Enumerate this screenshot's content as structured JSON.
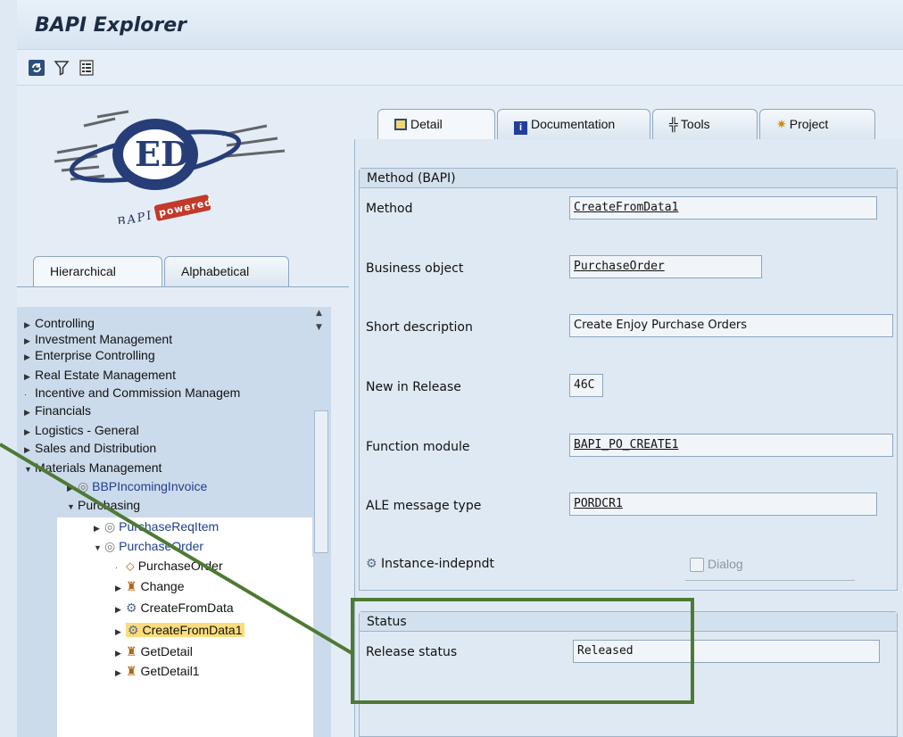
{
  "app": {
    "title": "BAPI Explorer"
  },
  "toolbar": {
    "icons": [
      "refresh-icon",
      "filter-icon",
      "list-icon"
    ]
  },
  "logo": {
    "text": "BAPI powered"
  },
  "left_tabs": [
    {
      "label": "Hierarchical",
      "active": true
    },
    {
      "label": "Alphabetical",
      "active": false
    }
  ],
  "tree": {
    "items": [
      {
        "label": "Controlling",
        "level": 0,
        "expander": "collapsed"
      },
      {
        "label": "Investment Management",
        "level": 0,
        "expander": "collapsed"
      },
      {
        "label": "Enterprise Controlling",
        "level": 0,
        "expander": "collapsed"
      },
      {
        "label": "Real Estate Management",
        "level": 0,
        "expander": "collapsed"
      },
      {
        "label": "Incentive and Commission Managem",
        "level": 0,
        "expander": "leaf"
      },
      {
        "label": "Financials",
        "level": 0,
        "expander": "collapsed"
      },
      {
        "label": "Logistics - General",
        "level": 0,
        "expander": "collapsed"
      },
      {
        "label": "Sales and Distribution",
        "level": 0,
        "expander": "collapsed"
      },
      {
        "label": "Materials Management",
        "level": 0,
        "expander": "expanded"
      },
      {
        "label": "BBPIncomingInvoice",
        "level": 1,
        "expander": "collapsed",
        "icon": "object-icon"
      },
      {
        "label": "Purchasing",
        "level": 1,
        "expander": "expanded"
      },
      {
        "label": "PurchaseReqItem",
        "level": 2,
        "expander": "collapsed",
        "icon": "object-icon"
      },
      {
        "label": "PurchaseOrder",
        "level": 2,
        "expander": "expanded",
        "icon": "object-icon"
      },
      {
        "label": "PurchaseOrder",
        "level": 3,
        "expander": "leaf",
        "icon": "key-icon"
      },
      {
        "label": "Change",
        "level": 3,
        "expander": "collapsed",
        "icon": "method-icon"
      },
      {
        "label": "CreateFromData",
        "level": 3,
        "expander": "collapsed",
        "icon": "instance-method-icon"
      },
      {
        "label": "CreateFromData1",
        "level": 3,
        "expander": "collapsed",
        "icon": "instance-method-icon",
        "selected": true
      },
      {
        "label": "GetDetail",
        "level": 3,
        "expander": "collapsed",
        "icon": "method-icon"
      },
      {
        "label": "GetDetail1",
        "level": 3,
        "expander": "collapsed",
        "icon": "method-icon"
      }
    ]
  },
  "right_tabs": [
    {
      "label": "Detail",
      "icon": "detail-icon",
      "active": true
    },
    {
      "label": "Documentation",
      "icon": "info-icon",
      "active": false
    },
    {
      "label": "Tools",
      "icon": "tools-icon",
      "active": false
    },
    {
      "label": "Project",
      "icon": "wand-icon",
      "active": false
    }
  ],
  "method_group": {
    "title": "Method (BAPI)",
    "fields": {
      "method": {
        "label": "Method",
        "value": "CreateFromData1"
      },
      "business_object": {
        "label": "Business object",
        "value": "PurchaseOrder"
      },
      "short_description": {
        "label": "Short description",
        "value": "Create Enjoy Purchase Orders"
      },
      "new_in_release": {
        "label": "New in Release",
        "value": "46C"
      },
      "function_module": {
        "label": "Function module",
        "value": "BAPI_PO_CREATE1"
      },
      "ale_message_type": {
        "label": "ALE message type",
        "value": "PORDCR1"
      }
    },
    "instance": {
      "label": "Instance-indepndt"
    },
    "dialog": {
      "label": "Dialog",
      "checked": false
    }
  },
  "status_group": {
    "title": "Status",
    "release_status": {
      "label": "Release status",
      "value": "Released"
    }
  },
  "colors": {
    "annotation": "#4e7a33",
    "selection": "#fbdd7d"
  }
}
